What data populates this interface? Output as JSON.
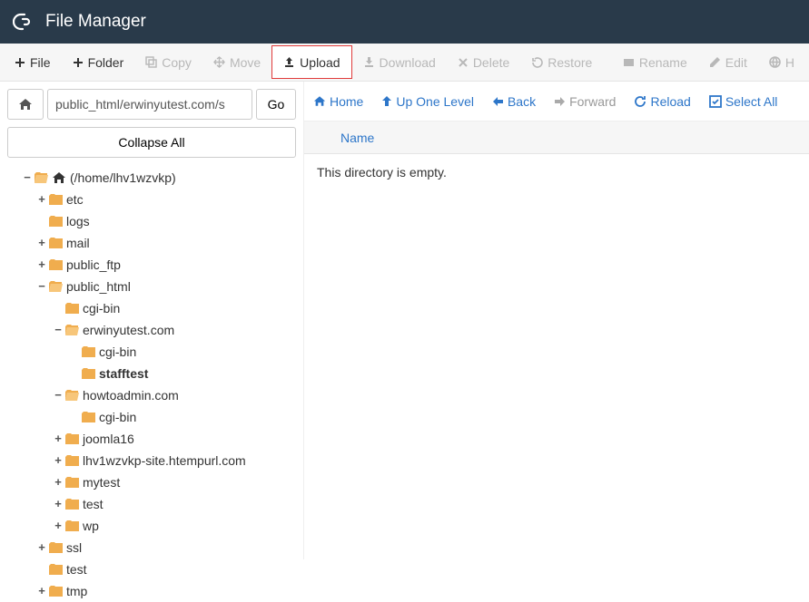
{
  "header": {
    "title": "File Manager"
  },
  "toolbar": {
    "file": "File",
    "folder": "Folder",
    "copy": "Copy",
    "move": "Move",
    "upload": "Upload",
    "download": "Download",
    "delete": "Delete",
    "restore": "Restore",
    "rename": "Rename",
    "edit": "Edit",
    "html_editor": "H"
  },
  "path_bar": {
    "value": "public_html/erwinyutest.com/s",
    "go": "Go"
  },
  "collapse_all": "Collapse All",
  "tree": {
    "root": "(/home/lhv1wzvkp)",
    "etc": "etc",
    "logs": "logs",
    "mail": "mail",
    "public_ftp": "public_ftp",
    "public_html": "public_html",
    "cgi_bin": "cgi-bin",
    "erwinyutest": "erwinyutest.com",
    "stafftest": "stafftest",
    "howtoadmin": "howtoadmin.com",
    "joomla16": "joomla16",
    "lhv_site": "lhv1wzvkp-site.htempurl.com",
    "mytest": "mytest",
    "test": "test",
    "wp": "wp",
    "ssl": "ssl",
    "tmp": "tmp"
  },
  "right_nav": {
    "home": "Home",
    "up": "Up One Level",
    "back": "Back",
    "forward": "Forward",
    "reload": "Reload",
    "select_all": "Select All"
  },
  "table": {
    "col_name": "Name"
  },
  "content": {
    "empty": "This directory is empty."
  }
}
